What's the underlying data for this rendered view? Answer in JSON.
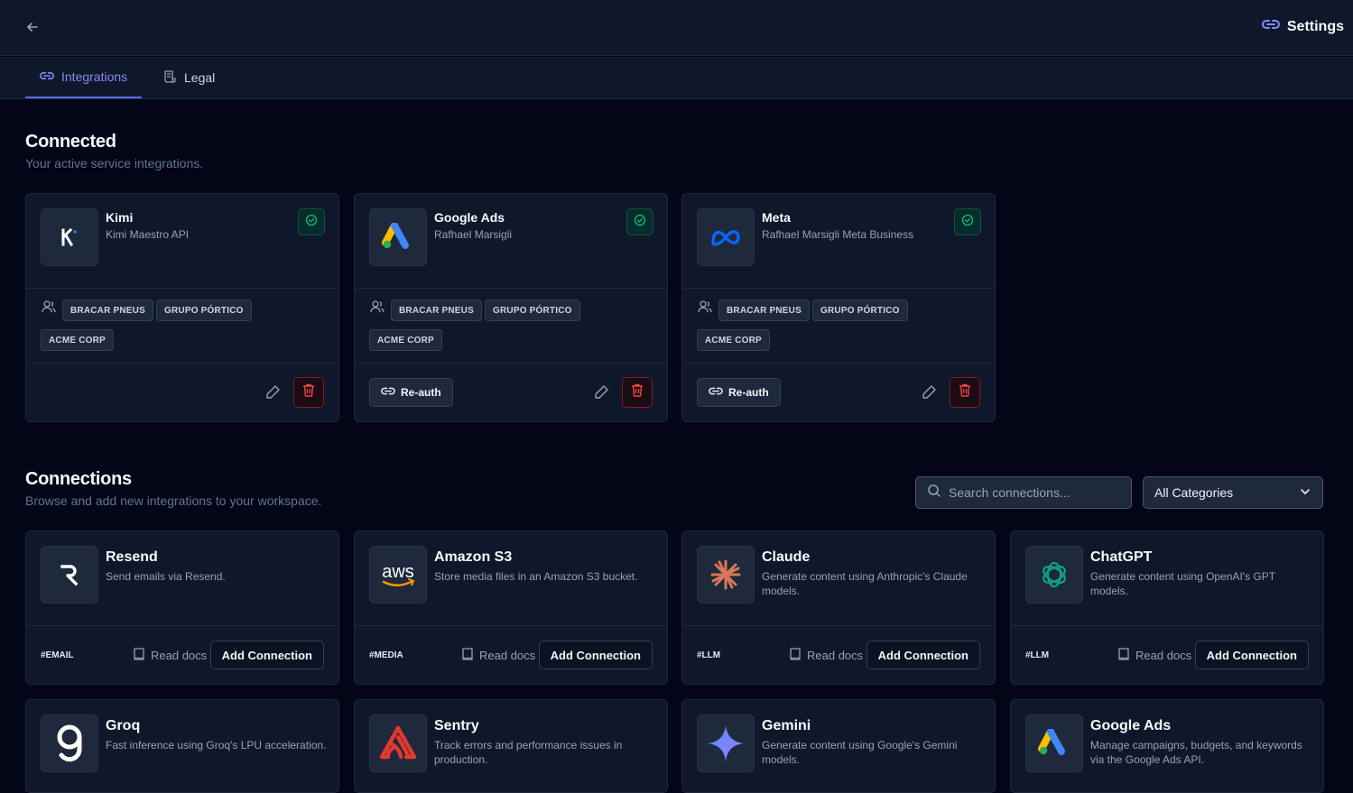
{
  "header": {
    "title": "Settings"
  },
  "tabs": [
    {
      "label": "Integrations",
      "active": true
    },
    {
      "label": "Legal",
      "active": false
    }
  ],
  "connected": {
    "title": "Connected",
    "subtitle": "Your active service integrations.",
    "reauth_label": "Re-auth",
    "cards": [
      {
        "name": "Kimi",
        "account": "Kimi Maestro API",
        "logo": "kimi-logo",
        "tags": [
          "BRACAR PNEUS",
          "GRUPO PÓRTICO",
          "ACME CORP"
        ],
        "has_reauth": false
      },
      {
        "name": "Google Ads",
        "account": "Rafhael Marsigli",
        "logo": "google-ads-logo",
        "tags": [
          "BRACAR PNEUS",
          "GRUPO PÓRTICO",
          "ACME CORP"
        ],
        "has_reauth": true
      },
      {
        "name": "Meta",
        "account": "Rafhael Marsigli Meta Business",
        "logo": "meta-logo",
        "tags": [
          "BRACAR PNEUS",
          "GRUPO PÓRTICO",
          "ACME CORP"
        ],
        "has_reauth": true
      }
    ]
  },
  "connections": {
    "title": "Connections",
    "subtitle": "Browse and add new integrations to your workspace.",
    "search_placeholder": "Search connections...",
    "category_selected": "All Categories",
    "read_docs_label": "Read docs",
    "add_label": "Add Connection",
    "cards": [
      {
        "name": "Resend",
        "description": "Send emails via Resend.",
        "tag": "#EMAIL",
        "logo": "resend-logo"
      },
      {
        "name": "Amazon S3",
        "description": "Store media files in an Amazon S3 bucket.",
        "tag": "#MEDIA",
        "logo": "aws-logo"
      },
      {
        "name": "Claude",
        "description": "Generate content using Anthropic's Claude models.",
        "tag": "#LLM",
        "logo": "claude-logo"
      },
      {
        "name": "ChatGPT",
        "description": "Generate content using OpenAI's GPT models.",
        "tag": "#LLM",
        "logo": "chatgpt-logo"
      },
      {
        "name": "Groq",
        "description": "Fast inference using Groq's LPU acceleration.",
        "tag": "",
        "logo": "groq-logo"
      },
      {
        "name": "Sentry",
        "description": "Track errors and performance issues in production.",
        "tag": "",
        "logo": "sentry-logo"
      },
      {
        "name": "Gemini",
        "description": "Generate content using Google's Gemini models.",
        "tag": "",
        "logo": "gemini-logo"
      },
      {
        "name": "Google Ads",
        "description": "Manage campaigns, budgets, and keywords via the Google Ads API.",
        "tag": "",
        "logo": "google-ads-logo"
      }
    ]
  },
  "colors": {
    "accent": "#818cf8",
    "background": "#020617",
    "card": "#0f172a",
    "success": "#10b981",
    "danger": "#ef4444"
  }
}
